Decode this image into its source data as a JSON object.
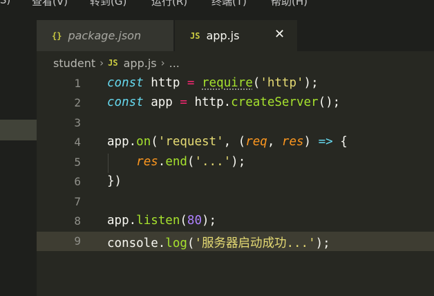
{
  "menubar": {
    "items": [
      "(S)",
      "查看(V)",
      "转到(G)",
      "运行(R)",
      "终端(T)",
      "帮助(H)"
    ]
  },
  "tabs": [
    {
      "icon": "{}",
      "label": "package.json"
    },
    {
      "icon": "JS",
      "label": "app.js",
      "close": "✕"
    }
  ],
  "breadcrumb": {
    "folder": "student",
    "file_icon": "JS",
    "file": "app.js",
    "more": "...",
    "separator": "›"
  },
  "editor": {
    "line_numbers": [
      "1",
      "2",
      "3",
      "4",
      "5",
      "6",
      "7",
      "8",
      "9"
    ],
    "lines": [
      [
        "const",
        " http ",
        "=",
        " ",
        "require",
        "(",
        "'http'",
        ");"
      ],
      [
        "const",
        " app ",
        "=",
        " http.",
        "createServer",
        "();"
      ],
      [
        ""
      ],
      [
        "app.",
        "on",
        "(",
        "'request'",
        ", (",
        "req",
        ", ",
        "res",
        ") ",
        "=>",
        " {"
      ],
      [
        "    ",
        "res",
        ".",
        "end",
        "(",
        "'...'",
        ");"
      ],
      [
        "})"
      ],
      [
        ""
      ],
      [
        "app.",
        "listen",
        "(",
        "80",
        ");"
      ],
      [
        "console.",
        "log",
        "(",
        "'服务器启动成功...'",
        ");"
      ]
    ],
    "current_line": 9
  }
}
